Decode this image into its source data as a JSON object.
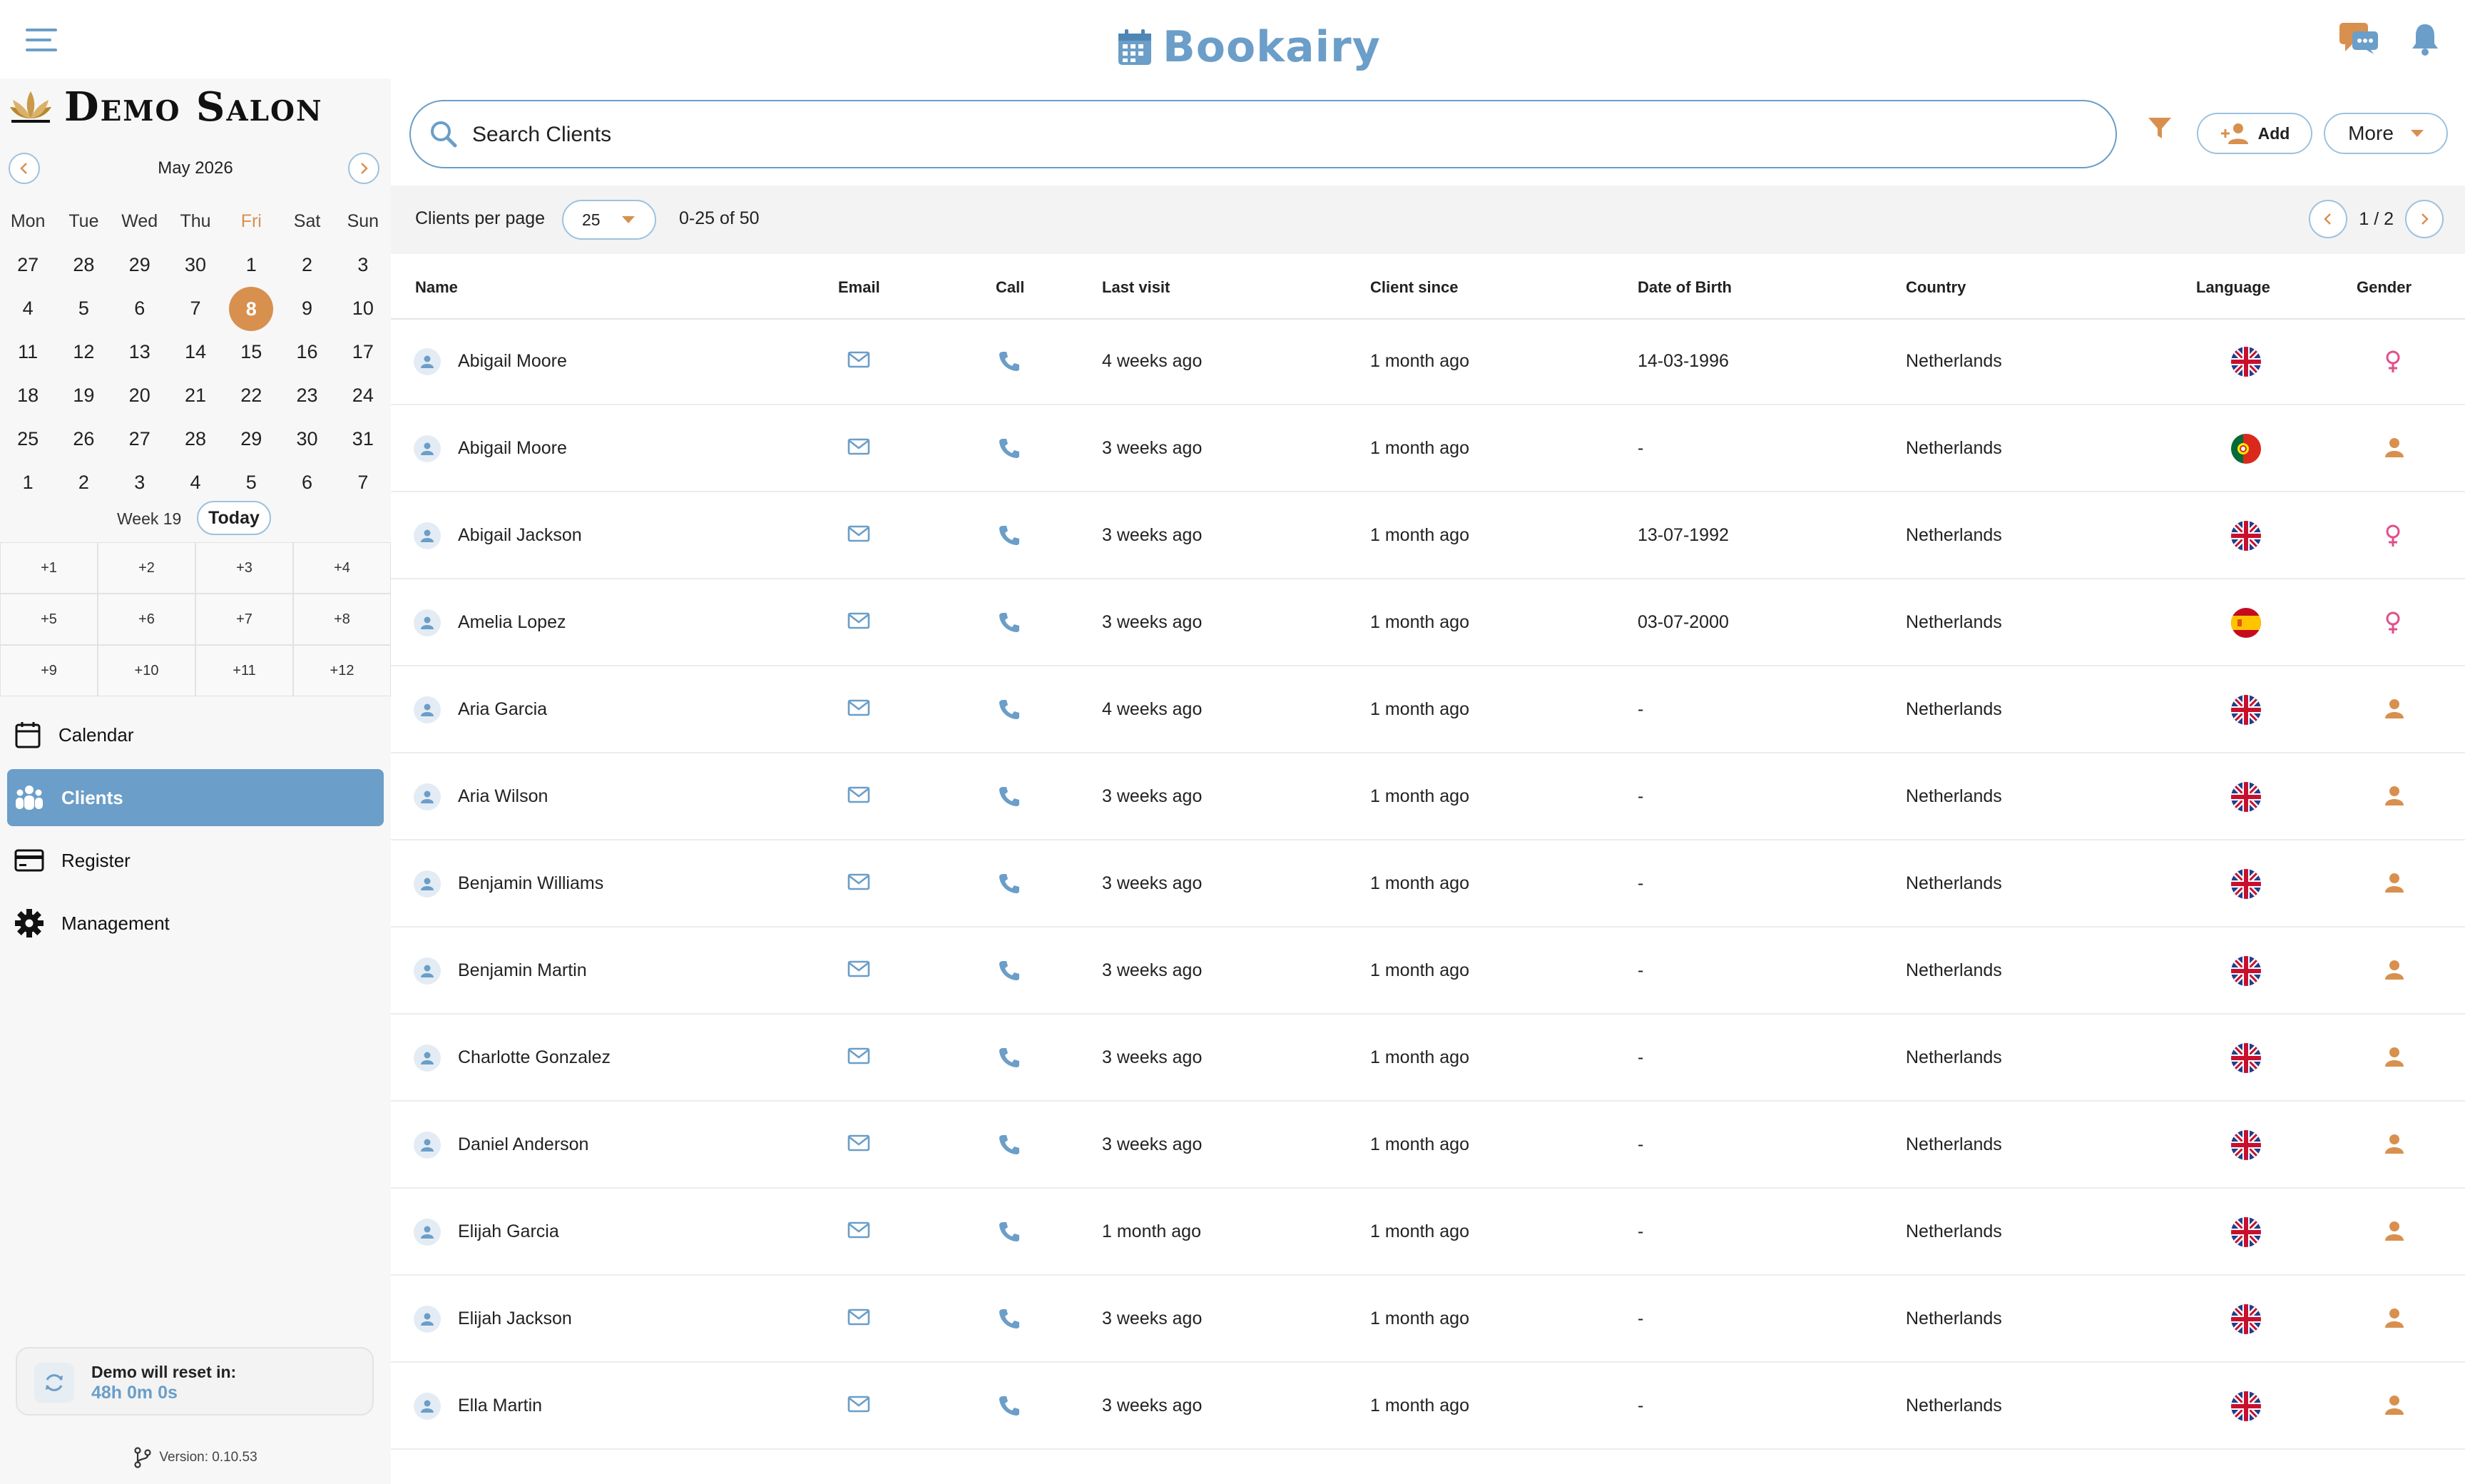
{
  "app": {
    "brand": "Bookairy",
    "salon_name": "Demo Salon"
  },
  "calendar": {
    "month_label": "May 2026",
    "weekdays": [
      "Mon",
      "Tue",
      "Wed",
      "Thu",
      "Fri",
      "Sat",
      "Sun"
    ],
    "weeks": [
      [
        "27",
        "28",
        "29",
        "30",
        "1",
        "2",
        "3"
      ],
      [
        "4",
        "5",
        "6",
        "7",
        "8",
        "9",
        "10"
      ],
      [
        "11",
        "12",
        "13",
        "14",
        "15",
        "16",
        "17"
      ],
      [
        "18",
        "19",
        "20",
        "21",
        "22",
        "23",
        "24"
      ],
      [
        "25",
        "26",
        "27",
        "28",
        "29",
        "30",
        "31"
      ],
      [
        "1",
        "2",
        "3",
        "4",
        "5",
        "6",
        "7"
      ]
    ],
    "selected_day": "8",
    "week_label": "Week 19",
    "today_label": "Today",
    "offsets": [
      "+1",
      "+2",
      "+3",
      "+4",
      "+5",
      "+6",
      "+7",
      "+8",
      "+9",
      "+10",
      "+11",
      "+12"
    ]
  },
  "nav": {
    "items": [
      {
        "label": "Calendar",
        "icon": "calendar-icon",
        "active": false
      },
      {
        "label": "Clients",
        "icon": "people-icon",
        "active": true
      },
      {
        "label": "Register",
        "icon": "credit-card-icon",
        "active": false
      },
      {
        "label": "Management",
        "icon": "gear-icon",
        "active": false
      }
    ]
  },
  "demo": {
    "reset_title": "Demo will reset in:",
    "reset_time": "48h 0m 0s",
    "version": "Version: 0.10.53"
  },
  "search": {
    "placeholder": "Search Clients"
  },
  "actions": {
    "add_label": "Add",
    "more_label": "More"
  },
  "toolbar": {
    "per_page_label": "Clients per page",
    "per_page_value": "25",
    "range": "0-25 of 50",
    "page": "1 / 2"
  },
  "colors": {
    "accent_blue": "#6b9ec8",
    "accent_orange": "#d8904f",
    "female_pink": "#e0508a",
    "active_nav": "#6b9ec8"
  },
  "table": {
    "columns": [
      "Name",
      "Email",
      "Call",
      "Last visit",
      "Client since",
      "Date of Birth",
      "Country",
      "Language",
      "Gender"
    ],
    "rows": [
      {
        "name": "Abigail Moore",
        "last_visit": "4 weeks ago",
        "client_since": "1 month ago",
        "dob": "14-03-1996",
        "country": "Netherlands",
        "language": "uk",
        "gender": "female"
      },
      {
        "name": "Abigail Moore",
        "last_visit": "3 weeks ago",
        "client_since": "1 month ago",
        "dob": "-",
        "country": "Netherlands",
        "language": "pt",
        "gender": "unknown"
      },
      {
        "name": "Abigail Jackson",
        "last_visit": "3 weeks ago",
        "client_since": "1 month ago",
        "dob": "13-07-1992",
        "country": "Netherlands",
        "language": "uk",
        "gender": "female"
      },
      {
        "name": "Amelia Lopez",
        "last_visit": "3 weeks ago",
        "client_since": "1 month ago",
        "dob": "03-07-2000",
        "country": "Netherlands",
        "language": "es",
        "gender": "female"
      },
      {
        "name": "Aria Garcia",
        "last_visit": "4 weeks ago",
        "client_since": "1 month ago",
        "dob": "-",
        "country": "Netherlands",
        "language": "uk",
        "gender": "unknown"
      },
      {
        "name": "Aria Wilson",
        "last_visit": "3 weeks ago",
        "client_since": "1 month ago",
        "dob": "-",
        "country": "Netherlands",
        "language": "uk",
        "gender": "unknown"
      },
      {
        "name": "Benjamin Williams",
        "last_visit": "3 weeks ago",
        "client_since": "1 month ago",
        "dob": "-",
        "country": "Netherlands",
        "language": "uk",
        "gender": "unknown"
      },
      {
        "name": "Benjamin Martin",
        "last_visit": "3 weeks ago",
        "client_since": "1 month ago",
        "dob": "-",
        "country": "Netherlands",
        "language": "uk",
        "gender": "unknown"
      },
      {
        "name": "Charlotte Gonzalez",
        "last_visit": "3 weeks ago",
        "client_since": "1 month ago",
        "dob": "-",
        "country": "Netherlands",
        "language": "uk",
        "gender": "unknown"
      },
      {
        "name": "Daniel Anderson",
        "last_visit": "3 weeks ago",
        "client_since": "1 month ago",
        "dob": "-",
        "country": "Netherlands",
        "language": "uk",
        "gender": "unknown"
      },
      {
        "name": "Elijah Garcia",
        "last_visit": "1 month ago",
        "client_since": "1 month ago",
        "dob": "-",
        "country": "Netherlands",
        "language": "uk",
        "gender": "unknown"
      },
      {
        "name": "Elijah Jackson",
        "last_visit": "3 weeks ago",
        "client_since": "1 month ago",
        "dob": "-",
        "country": "Netherlands",
        "language": "uk",
        "gender": "unknown"
      },
      {
        "name": "Ella Martin",
        "last_visit": "3 weeks ago",
        "client_since": "1 month ago",
        "dob": "-",
        "country": "Netherlands",
        "language": "uk",
        "gender": "unknown"
      }
    ]
  }
}
